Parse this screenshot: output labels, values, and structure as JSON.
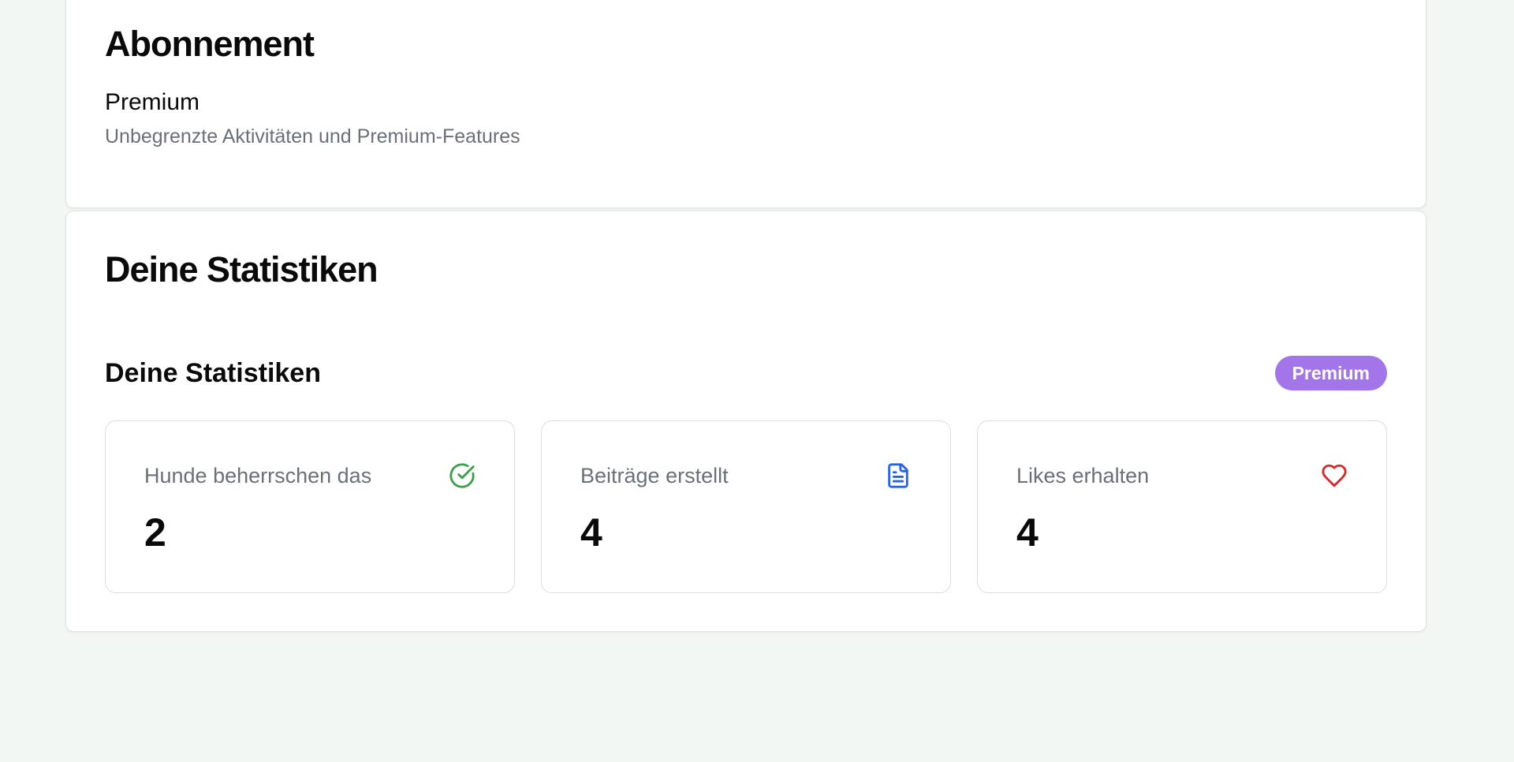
{
  "subscription": {
    "title": "Abonnement",
    "plan_name": "Premium",
    "plan_description": "Unbegrenzte Aktivitäten und Premium-Features"
  },
  "stats": {
    "card_title": "Deine Statistiken",
    "section_title": "Deine Statistiken",
    "badge_label": "Premium",
    "badge_color": "#a275e8",
    "items": [
      {
        "label": "Hunde beherrschen das",
        "value": "2",
        "icon": "check-circle-icon",
        "icon_color": "#3aa14a"
      },
      {
        "label": "Beiträge erstellt",
        "value": "4",
        "icon": "document-icon",
        "icon_color": "#2563eb"
      },
      {
        "label": "Likes erhalten",
        "value": "4",
        "icon": "heart-icon",
        "icon_color": "#dc2626"
      }
    ]
  }
}
